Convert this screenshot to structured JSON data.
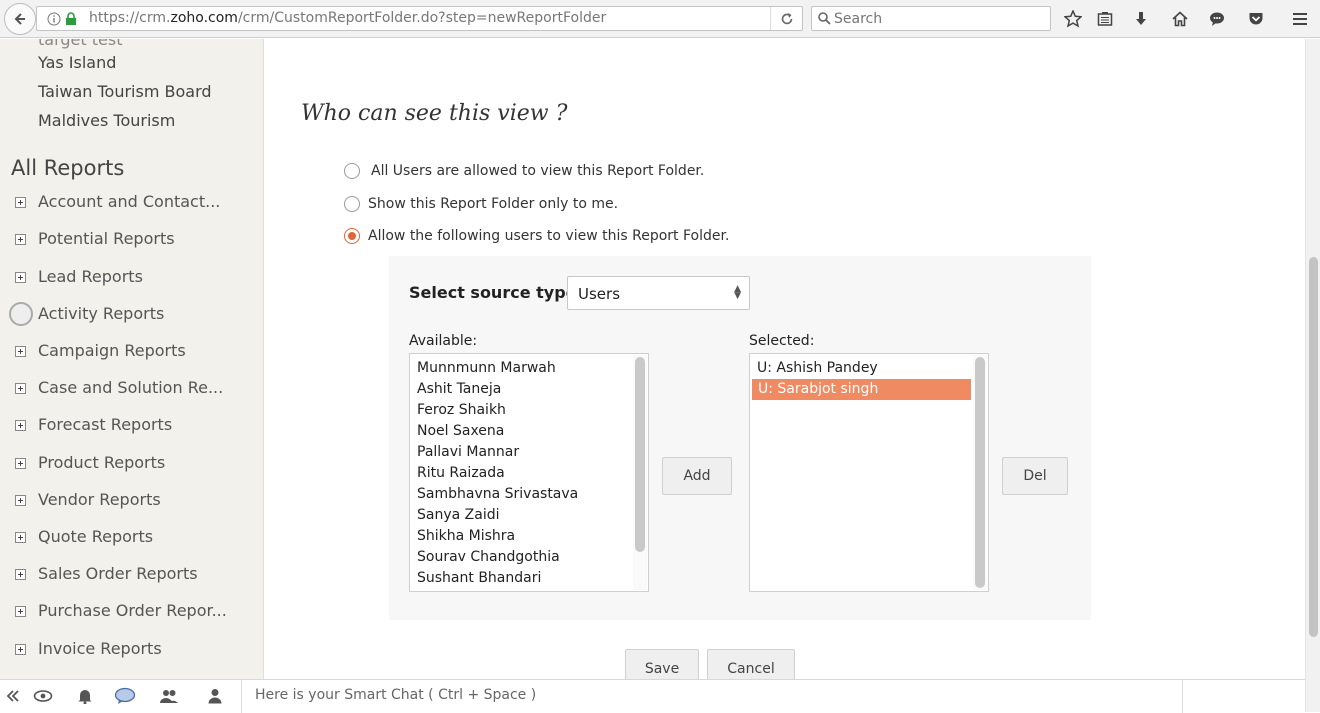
{
  "browser": {
    "url_prefix": "https://crm.",
    "url_domain": "zoho.com",
    "url_path": "/crm/CustomReportFolder.do?step=newReportFolder",
    "search_placeholder": "Search"
  },
  "sidebar": {
    "partial_top_item": "target test",
    "folder_links": [
      "Yas Island",
      "Taiwan Tourism Board",
      "Maldives Tourism"
    ],
    "heading": "All Reports",
    "report_items": [
      "Account and Contact...",
      "Potential Reports",
      "Lead Reports",
      "Activity Reports",
      "Campaign Reports",
      "Case and Solution Re...",
      "Forecast Reports",
      "Product Reports",
      "Vendor Reports",
      "Quote Reports",
      "Sales Order Reports",
      "Purchase Order Repor...",
      "Invoice Reports"
    ]
  },
  "main": {
    "title": "Who can see this view ?",
    "radio_options": [
      {
        "label": "All Users are allowed to view this Report Folder.",
        "checked": false
      },
      {
        "label": "Show this Report Folder only to me.",
        "checked": false
      },
      {
        "label": "Allow the following users to view this Report Folder.",
        "checked": true
      }
    ],
    "source_type_label": "Select source type:",
    "source_type_value": "Users",
    "available_label": "Available:",
    "available_users": [
      "Munnmunn Marwah",
      "Ashit Taneja",
      "Feroz Shaikh",
      "Noel Saxena",
      "Pallavi Mannar",
      "Ritu Raizada",
      "Sambhavna Srivastava",
      "Sanya Zaidi",
      "Shikha Mishra",
      "Sourav Chandgothia",
      "Sushant Bhandari"
    ],
    "selected_label": "Selected:",
    "selected_users": [
      "U: Ashish Pandey",
      "U: Sarabjot singh"
    ],
    "highlighted_selected_index": 1,
    "add_label": "Add",
    "del_label": "Del",
    "save_label": "Save",
    "cancel_label": "Cancel"
  },
  "bottombar": {
    "chat_placeholder": "Here is your Smart Chat ( Ctrl + Space )"
  },
  "colors": {
    "accent": "#e0643a",
    "selection": "#ef8a62",
    "sidebar_bg": "#f3f1ec"
  }
}
